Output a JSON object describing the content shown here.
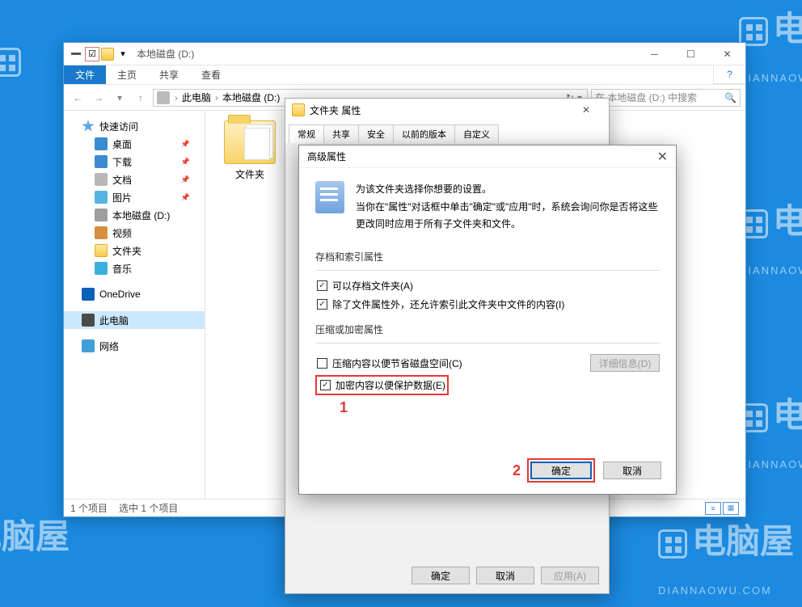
{
  "watermark": {
    "brand": "电脑屋",
    "url": "DIANNAOWU.COM"
  },
  "explorer": {
    "title": "本地磁盘 (D:)",
    "ribbon": {
      "file": "文件",
      "home": "主页",
      "share": "共享",
      "view": "查看"
    },
    "breadcrumb": {
      "root": "此电脑",
      "drive": "本地磁盘 (D:)"
    },
    "search_placeholder": "在 本地磁盘 (D:) 中搜索",
    "sidebar": {
      "quick": "快速访问",
      "desktop": "桌面",
      "downloads": "下载",
      "documents": "文档",
      "pictures": "图片",
      "drive_d": "本地磁盘 (D:)",
      "videos": "视频",
      "folder": "文件夹",
      "music": "音乐",
      "onedrive": "OneDrive",
      "thispc": "此电脑",
      "network": "网络"
    },
    "folder_item": "文件夹",
    "status": {
      "count": "1 个项目",
      "selected": "选中 1 个项目"
    }
  },
  "prop": {
    "title": "文件夹 属性",
    "tabs": [
      "常规",
      "共享",
      "安全",
      "以前的版本",
      "自定义"
    ],
    "ok": "确定",
    "cancel": "取消",
    "apply": "应用(A)"
  },
  "adv": {
    "title": "高级属性",
    "line1": "为该文件夹选择你想要的设置。",
    "line2": "当你在\"属性\"对话框中单击\"确定\"或\"应用\"时，系统会询问你是否将这些更改同时应用于所有子文件夹和文件。",
    "group1_title": "存档和索引属性",
    "chk_archive": "可以存档文件夹(A)",
    "chk_index": "除了文件属性外，还允许索引此文件夹中文件的内容(I)",
    "group2_title": "压缩或加密属性",
    "chk_compress": "压缩内容以便节省磁盘空间(C)",
    "chk_encrypt": "加密内容以便保护数据(E)",
    "details": "详细信息(D)",
    "ok": "确定",
    "cancel": "取消",
    "annot1": "1",
    "annot2": "2"
  }
}
